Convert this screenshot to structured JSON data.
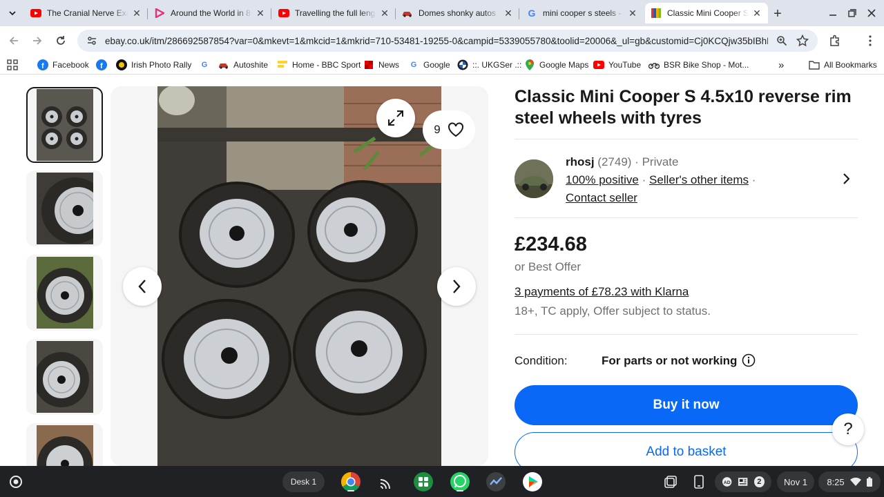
{
  "browser": {
    "tabs": [
      {
        "title": "The Cranial Nerve Exa",
        "icon": "youtube-icon",
        "color": "#ff0000"
      },
      {
        "title": "Around the World in 8",
        "icon": "video-play-icon",
        "color": "#e6327a"
      },
      {
        "title": "Travelling the full leng",
        "icon": "youtube-icon",
        "color": "#ff0000"
      },
      {
        "title": "Domes shonky autos",
        "icon": "car-icon",
        "color": "#555555"
      },
      {
        "title": "mini cooper s steels - G",
        "icon": "google-icon",
        "color": "#4285f4"
      },
      {
        "title": "Classic Mini Cooper S",
        "icon": "ebay-icon",
        "color": "#e53238"
      }
    ],
    "url": "ebay.co.uk/itm/286692587854?var=0&mkevt=1&mkcid=1&mkrid=710-53481-19255-0&campid=5339055780&toolid=20006&_ul=gb&customid=Cj0KCQjw35bIBhD...",
    "bookmarks": [
      {
        "label": "Facebook",
        "icon": "facebook-icon"
      },
      {
        "label": "",
        "icon": "facebook-icon"
      },
      {
        "label": "Irish Photo Rally",
        "icon": "photo-rally-icon"
      },
      {
        "label": "",
        "icon": "google-icon"
      },
      {
        "label": "Autoshite",
        "icon": "car-icon"
      },
      {
        "label": "Home - BBC Sport",
        "icon": "bbc-sport-icon"
      },
      {
        "label": "News",
        "icon": "news-icon"
      },
      {
        "label": "Google",
        "icon": "google-icon"
      },
      {
        "label": "::. UKGSer .::",
        "icon": "bmw-icon"
      },
      {
        "label": "Google Maps",
        "icon": "maps-pin-icon"
      },
      {
        "label": "YouTube",
        "icon": "youtube-icon"
      },
      {
        "label": "BSR Bike Shop - Mot...",
        "icon": "motorbike-icon"
      }
    ],
    "all_bookmarks": "All Bookmarks"
  },
  "listing": {
    "title": "Classic Mini Cooper S 4.5x10 reverse rim steel wheels with tyres",
    "watch_count": "9",
    "seller": {
      "name": "rhosj",
      "feedback_count": "(2749)",
      "type": "Private",
      "positive": "100% positive",
      "other_items": "Seller's other items",
      "contact": "Contact seller"
    },
    "price": "£234.68",
    "best_offer": "or Best Offer",
    "klarna": "3 payments of £78.23 with Klarna",
    "terms": "18+, TC apply, Offer subject to status.",
    "condition_label": "Condition:",
    "condition_value": "For parts or not working",
    "buy_now": "Buy it now",
    "add_to_basket": "Add to basket",
    "help": "?",
    "accent_color": "#0968f6"
  },
  "shelf": {
    "desk": "Desk 1",
    "notification_count": "2",
    "date": "Nov 1",
    "time": "8:25"
  }
}
